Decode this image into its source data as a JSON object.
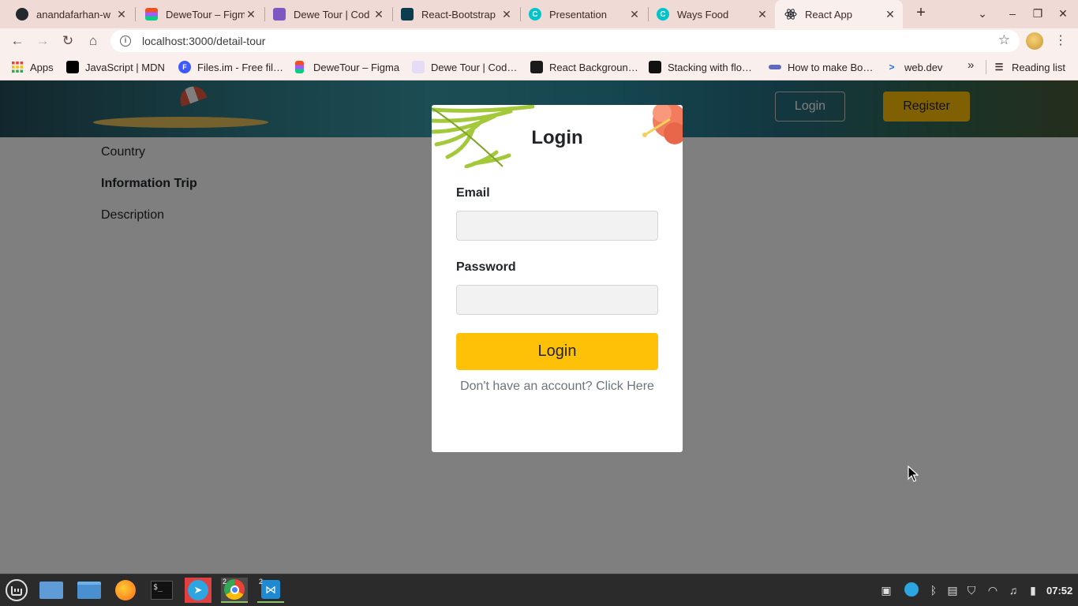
{
  "browser": {
    "tabs": [
      {
        "title": "anandafarhan-w",
        "icon": "github-icon",
        "color": "#24292e",
        "glyph": ""
      },
      {
        "title": "DeweTour – Figm",
        "icon": "figma-icon",
        "color": "#f24e1e",
        "glyph": ""
      },
      {
        "title": "Dewe Tour | Cod",
        "icon": "codepolitan-icon",
        "color": "#7e57c2",
        "glyph": ""
      },
      {
        "title": "React-Bootstrap",
        "icon": "react-bootstrap-icon",
        "color": "#0b3d4f",
        "glyph": ""
      },
      {
        "title": "Presentation",
        "icon": "canva-icon",
        "color": "#00c4cc",
        "glyph": "C"
      },
      {
        "title": "Ways Food",
        "icon": "canva-icon",
        "color": "#00c4cc",
        "glyph": "C"
      },
      {
        "title": "React App",
        "icon": "react-icon",
        "color": "#20232a",
        "glyph": ""
      }
    ],
    "url": "localhost:3000/detail-tour",
    "bookmarks": [
      {
        "label": "Apps",
        "icon": "apps-grid-icon",
        "color": "#ea4335"
      },
      {
        "label": "JavaScript | MDN",
        "icon": "mdn-icon",
        "color": "#000000"
      },
      {
        "label": "Files.im - Free fil…",
        "icon": "filesim-icon",
        "color": "#3d5afe"
      },
      {
        "label": "DeweTour – Figma",
        "icon": "figma-icon",
        "color": "#f24e1e"
      },
      {
        "label": "Dewe Tour | Cod…",
        "icon": "codepolitan-icon",
        "color": "#7e57c2"
      },
      {
        "label": "React Backgroun…",
        "icon": "react-bg-icon",
        "color": "#1a1a1a"
      },
      {
        "label": "Stacking with flo…",
        "icon": "stacking-icon",
        "color": "#111111"
      },
      {
        "label": "How to make Bo…",
        "icon": "howto-icon",
        "color": "#5c6bc0"
      },
      {
        "label": "web.dev",
        "icon": "webdev-icon",
        "color": "#1a73e8"
      }
    ],
    "reading_list": "Reading list"
  },
  "page": {
    "nav": {
      "login": "Login",
      "register": "Register"
    },
    "detail": {
      "country": "Country",
      "info_trip": "Information Trip",
      "description": "Description"
    }
  },
  "modal": {
    "title": "Login",
    "email_label": "Email",
    "email_value": "",
    "password_label": "Password",
    "password_value": "",
    "submit": "Login",
    "signup_text": "Don't have an account? Click Here"
  },
  "taskbar": {
    "chrome_count": "2",
    "vscode_count": "2",
    "clock": "07:52"
  },
  "colors": {
    "accent": "#ffc107",
    "tab_strip": "#f0dad5",
    "toolbar": "#f9efec"
  }
}
